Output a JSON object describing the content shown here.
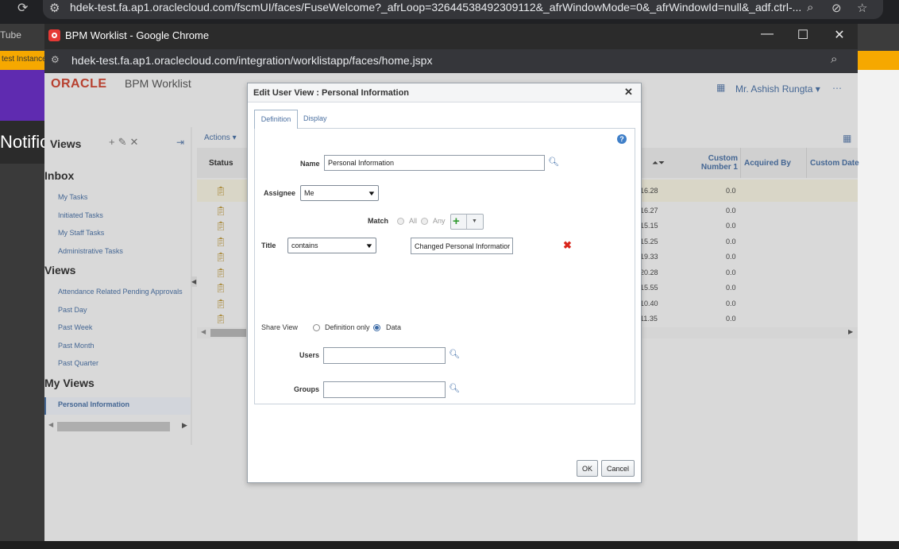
{
  "outer_browser": {
    "url": "hdek-test.fa.ap1.oraclecloud.com/fscmUI/faces/FuseWelcome?_afrLoop=32644538492309112&_afrWindowMode=0&_afrWindowId=null&_adf.ctrl-..."
  },
  "background": {
    "tube_text": "Tube",
    "test_instance_text": "test Instance",
    "notifications_text": "Notific"
  },
  "popup_window": {
    "title": "BPM Worklist - Google Chrome",
    "url": "hdek-test.fa.ap1.oraclecloud.com/integration/worklistapp/faces/home.jspx"
  },
  "app": {
    "logo": "ORACLE",
    "title": "BPM Worklist",
    "user": "Mr. Ashish Rungta"
  },
  "nav": {
    "views_title": "Views",
    "inbox_heading": "Inbox",
    "inbox_items": [
      "My Tasks",
      "Initiated Tasks",
      "My Staff Tasks",
      "Administrative Tasks"
    ],
    "views_heading": "Views",
    "views_items": [
      "Attendance Related Pending Approvals",
      "Past Day",
      "Past Week",
      "Past Month",
      "Past Quarter"
    ],
    "my_views_heading": "My Views",
    "my_views_items": [
      "Personal Information"
    ]
  },
  "table": {
    "actions_label": "Actions",
    "status_header": "Status",
    "custom_number_header_line1": "Custom",
    "custom_number_header_line2": "Number 1",
    "acquired_by_header": "Acquired By",
    "custom_date_header": "Custom Date",
    "rows": [
      {
        "num": "16.28",
        "custom1": "0.0"
      },
      {
        "num": "16.27",
        "custom1": "0.0"
      },
      {
        "num": "15.15",
        "custom1": "0.0"
      },
      {
        "num": "15.25",
        "custom1": "0.0"
      },
      {
        "num": "19.33",
        "custom1": "0.0"
      },
      {
        "num": "20.28",
        "custom1": "0.0"
      },
      {
        "num": "15.55",
        "custom1": "0.0"
      },
      {
        "num": "10.40",
        "custom1": "0.0"
      },
      {
        "num": "11.35",
        "custom1": "0.0"
      }
    ]
  },
  "dialog": {
    "title": "Edit User View : Personal Information",
    "tabs": {
      "definition": "Definition",
      "display": "Display"
    },
    "name_label": "Name",
    "name_value": "Personal Information",
    "assignee_label": "Assignee",
    "assignee_value": "Me",
    "match_label": "Match",
    "match_all": "All",
    "match_any": "Any",
    "condition_field": "Title",
    "condition_operator": "contains",
    "condition_value": "Changed Personal Informatior",
    "share_view_label": "Share View",
    "share_definition_only": "Definition only",
    "share_data": "Data",
    "users_label": "Users",
    "users_value": "",
    "groups_label": "Groups",
    "groups_value": "",
    "ok_label": "OK",
    "cancel_label": "Cancel"
  }
}
